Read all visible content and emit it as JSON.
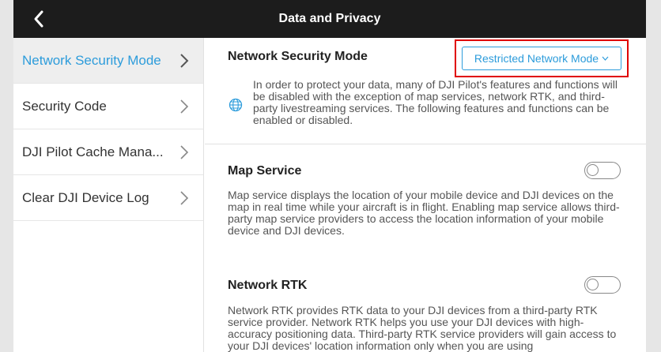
{
  "header": {
    "title": "Data and Privacy",
    "back_icon": "chevron-left-icon"
  },
  "sidebar": {
    "items": [
      {
        "label": "Network Security Mode",
        "active": true
      },
      {
        "label": "Security Code",
        "active": false
      },
      {
        "label": "DJI Pilot Cache Mana...",
        "active": false
      },
      {
        "label": "Clear DJI Device Log",
        "active": false
      }
    ]
  },
  "main": {
    "network_security": {
      "title": "Network Security Mode",
      "mode_value": "Restricted Network Mode",
      "description": "In order to protect your data, many of DJI Pilot's features and functions will be disabled with the exception of map services, network RTK, and third-party livestreaming services. The following features and functions can be enabled or disabled.",
      "icon": "globe-icon"
    },
    "map_service": {
      "title": "Map Service",
      "enabled": false,
      "description": "Map service displays the location of your mobile device and DJI devices on the map in real time while your aircraft is in flight. Enabling map service allows third-party map service providers to access the location information of your mobile device and DJI devices."
    },
    "network_rtk": {
      "title": "Network RTK",
      "enabled": false,
      "description": "Network RTK provides RTK data to your DJI devices from a third-party RTK service provider. Network RTK helps you use your DJI devices with high-accuracy positioning data. Third-party RTK service providers will gain access to your DJI devices' location information only when you are using"
    }
  },
  "colors": {
    "accent": "#2d9cdb",
    "header_bg": "#1c1c1c",
    "highlight": "#e00000"
  }
}
